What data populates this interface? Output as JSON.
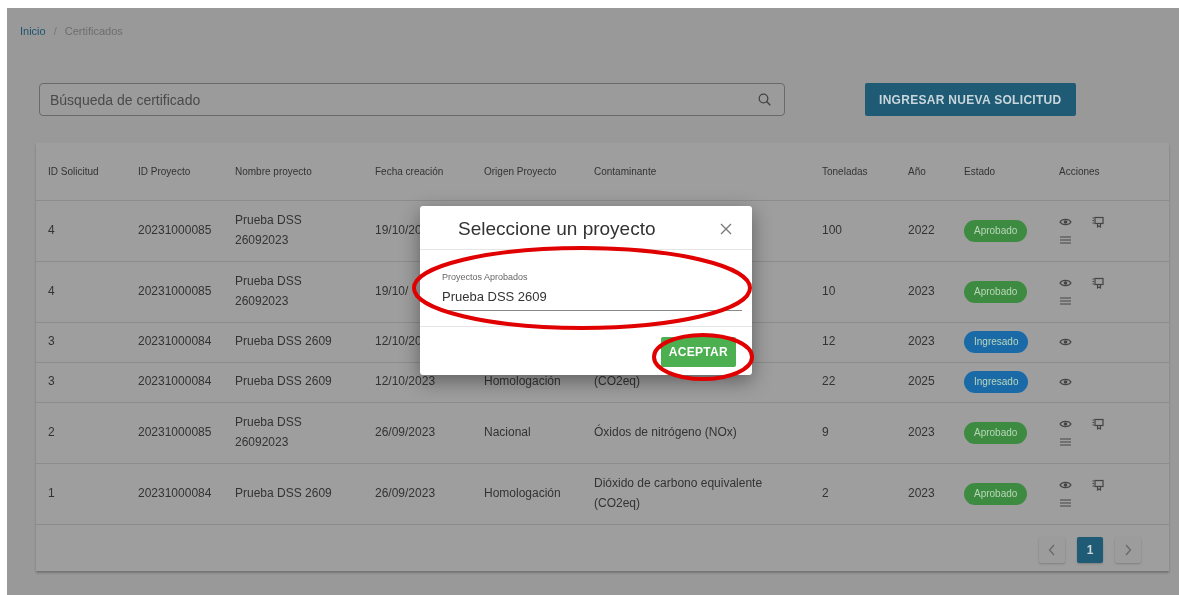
{
  "breadcrumb": {
    "separator": "/",
    "items": [
      {
        "label": "Inicio",
        "kind": "link"
      },
      {
        "label": "Certificados",
        "kind": "current"
      }
    ]
  },
  "search": {
    "placeholder": "Búsqueda de certificado"
  },
  "new_request_button": "INGRESAR NUEVA SOLICITUD",
  "table": {
    "columns": [
      "ID Solicitud",
      "ID Proyecto",
      "Nombre proyecto",
      "Fecha creación",
      "Origen Proyecto",
      "Contaminante",
      "Toneladas",
      "Año",
      "Estado",
      "Acciones"
    ],
    "rows": [
      {
        "id_solicitud": "4",
        "id_proyecto": "20231000085",
        "nombre": "Prueba DSS 26092023",
        "fecha": "19/10/20",
        "toneladas": "100",
        "anio": "2022",
        "estado": {
          "label": "Aprobado",
          "color": "#3d8b40"
        },
        "acciones": [
          {
            "kind": "view"
          },
          {
            "kind": "certificate"
          },
          {
            "kind": "list"
          }
        ]
      },
      {
        "id_solicitud": "4",
        "id_proyecto": "20231000085",
        "nombre": "Prueba DSS 26092023",
        "fecha": "19/10/",
        "toneladas": "10",
        "anio": "2023",
        "estado": {
          "label": "Aprobado",
          "color": "#3d8b40"
        },
        "acciones": [
          {
            "kind": "view"
          },
          {
            "kind": "certificate"
          },
          {
            "kind": "list"
          }
        ]
      },
      {
        "id_solicitud": "3",
        "id_proyecto": "20231000084",
        "nombre": "Prueba DSS 2609",
        "fecha": "12/10/20",
        "toneladas": "12",
        "anio": "2023",
        "estado": {
          "label": "Ingresado",
          "color": "#1a6aa8"
        },
        "acciones": [
          {
            "kind": "view"
          }
        ]
      },
      {
        "id_solicitud": "3",
        "id_proyecto": "20231000084",
        "nombre": "Prueba DSS 2609",
        "fecha": "12/10/2023",
        "origen": "Homologación",
        "contaminante": "(CO2eq)",
        "toneladas": "22",
        "anio": "2025",
        "estado": {
          "label": "Ingresado",
          "color": "#1a6aa8"
        },
        "acciones": [
          {
            "kind": "view"
          }
        ]
      },
      {
        "id_solicitud": "2",
        "id_proyecto": "20231000085",
        "nombre": "Prueba DSS 26092023",
        "fecha": "26/09/2023",
        "origen": "Nacional",
        "contaminante": "Óxidos de nitrógeno (NOx)",
        "toneladas": "9",
        "anio": "2023",
        "estado": {
          "label": "Aprobado",
          "color": "#3d8b40"
        },
        "acciones": [
          {
            "kind": "view"
          },
          {
            "kind": "certificate"
          },
          {
            "kind": "list"
          }
        ]
      },
      {
        "id_solicitud": "1",
        "id_proyecto": "20231000084",
        "nombre": "Prueba DSS 2609",
        "fecha": "26/09/2023",
        "origen": "Homologación",
        "contaminante": "Dióxido de carbono equivalente (CO2eq)",
        "toneladas": "2",
        "anio": "2023",
        "estado": {
          "label": "Aprobado",
          "color": "#3d8b40"
        },
        "acciones": [
          {
            "kind": "view"
          },
          {
            "kind": "certificate"
          },
          {
            "kind": "list"
          }
        ]
      }
    ]
  },
  "pagination": {
    "pages": [
      {
        "label": "1",
        "selected": true
      }
    ]
  },
  "modal": {
    "title": "Seleccione un proyecto",
    "field": {
      "label": "Proyectos Aprobados",
      "value": "Prueba DSS 2609"
    },
    "button": "ACEPTAR"
  }
}
